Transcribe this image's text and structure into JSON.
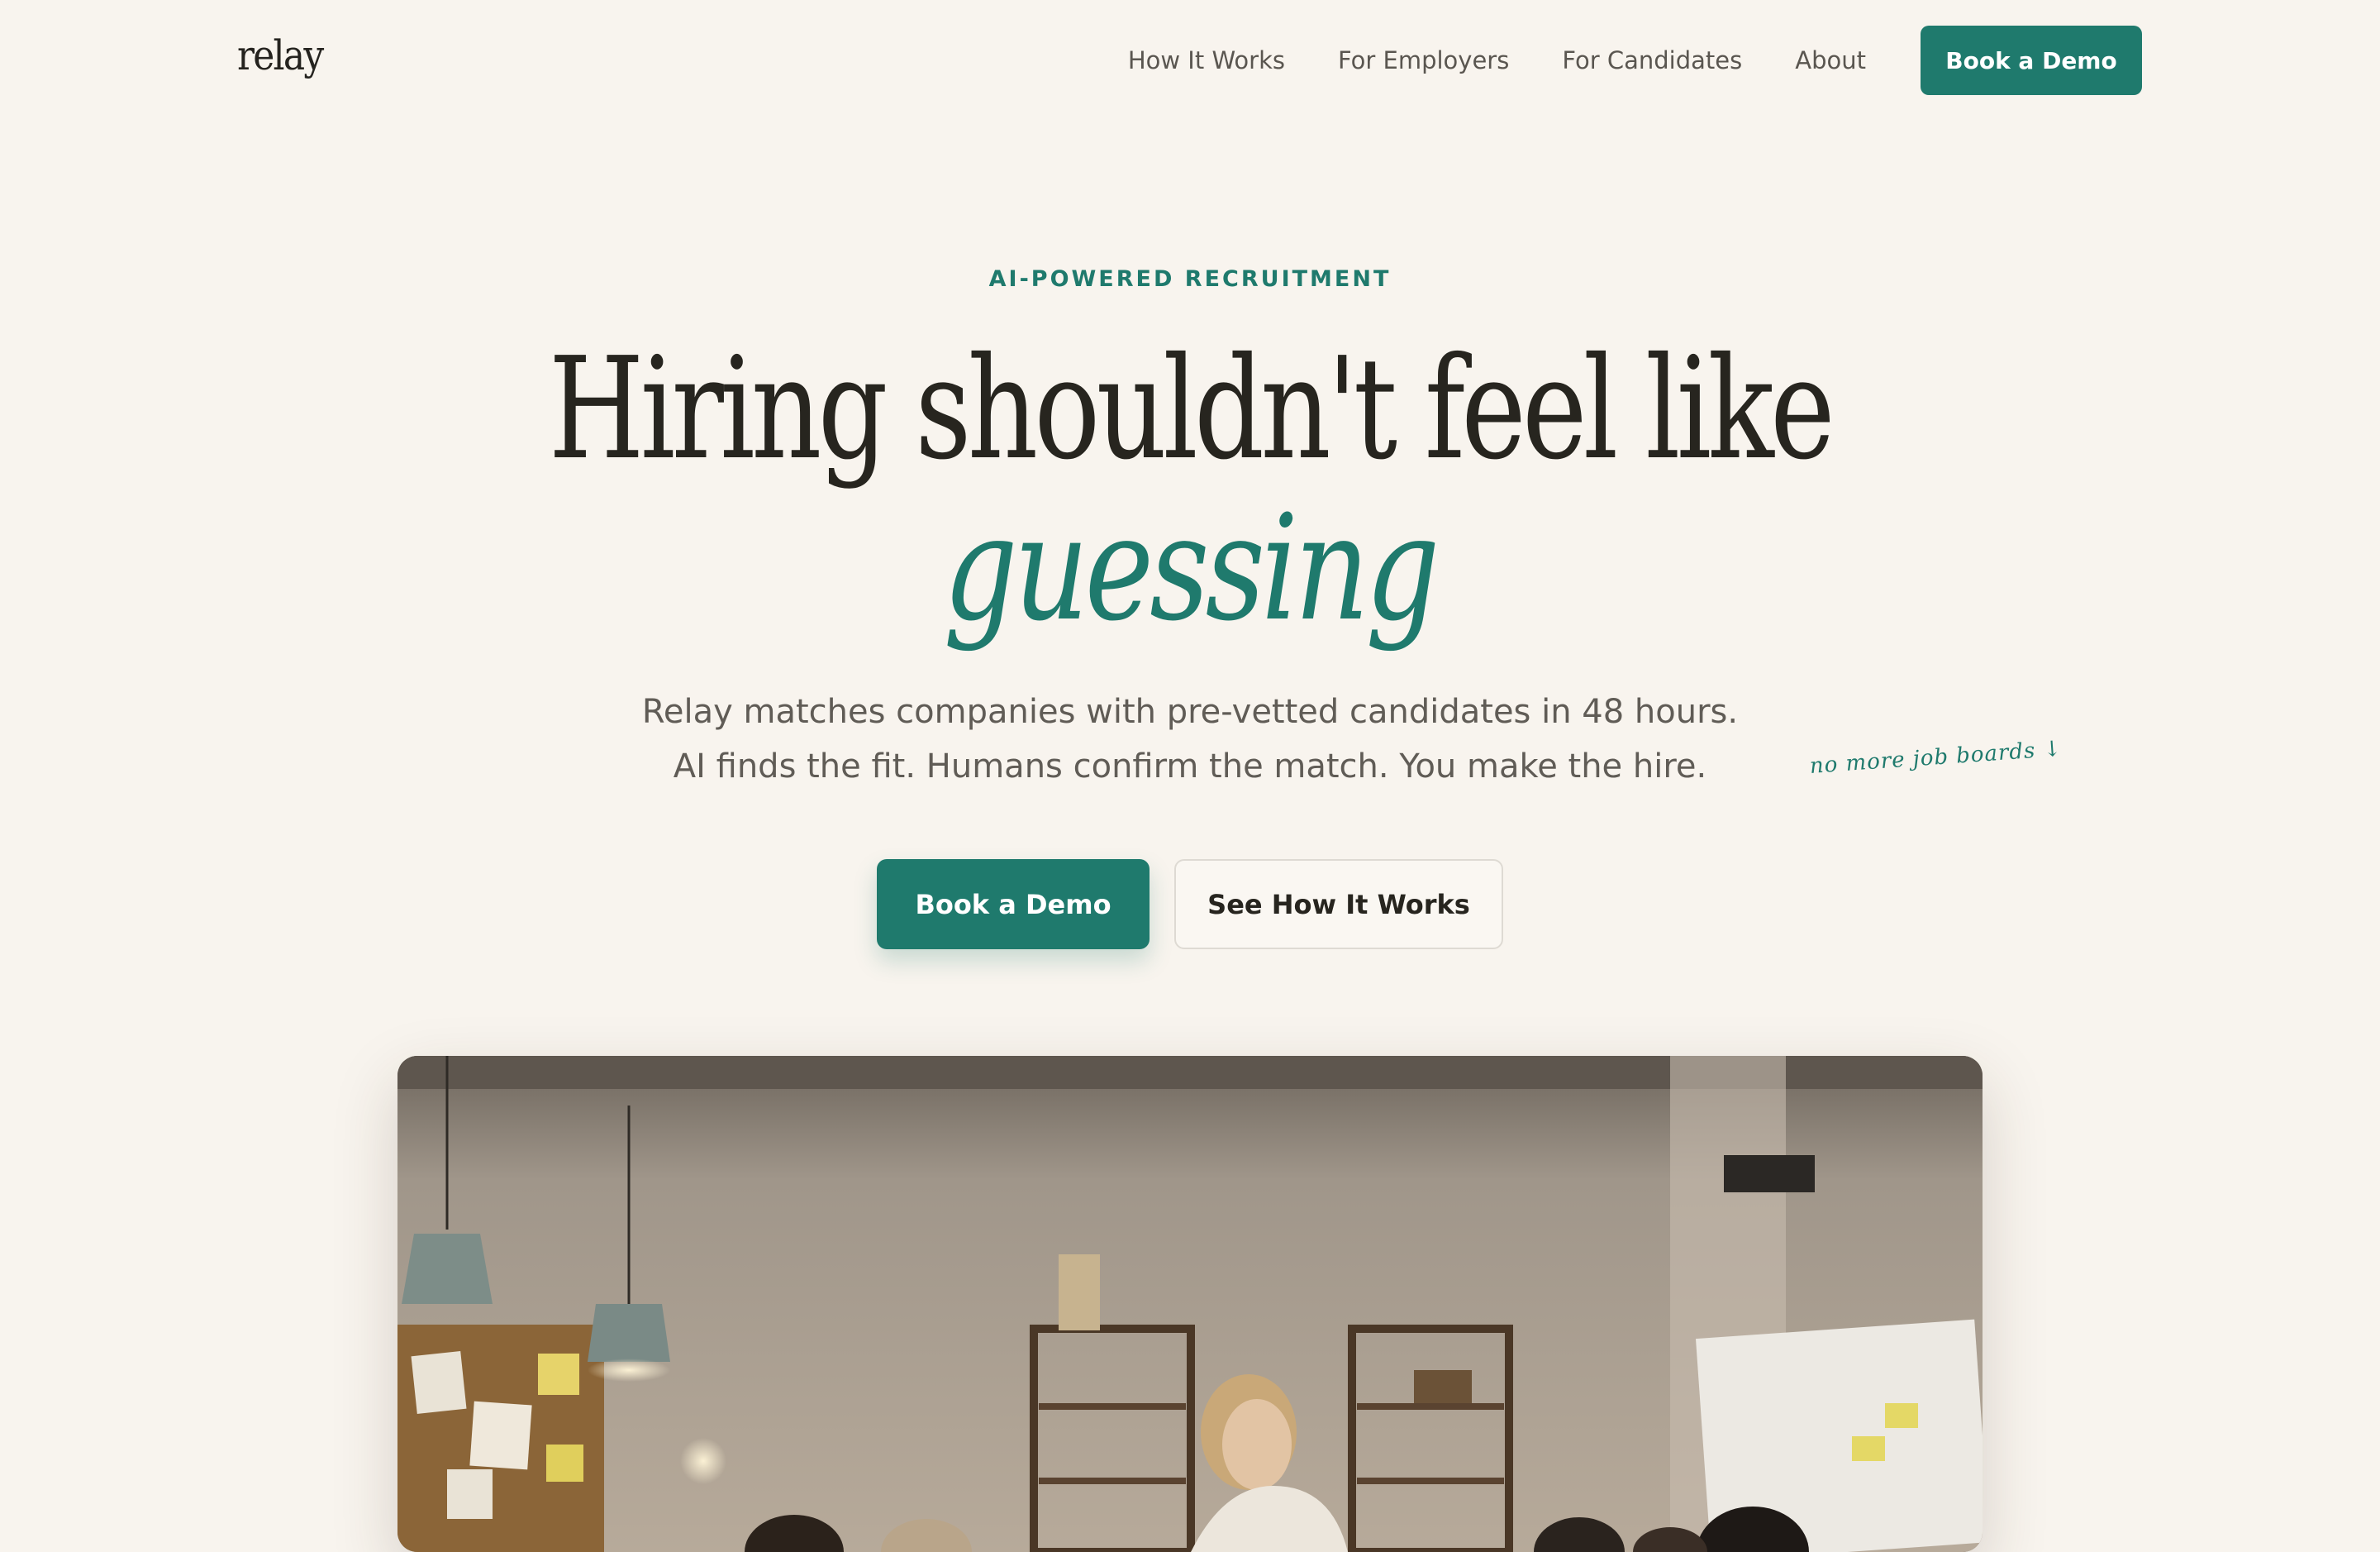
{
  "nav": {
    "logo": "relay",
    "links": [
      "How It Works",
      "For Employers",
      "For Candidates",
      "About"
    ],
    "cta": "Book a Demo"
  },
  "hero": {
    "eyebrow": "AI-POWERED RECRUITMENT",
    "headline": "Hiring shouldn't feel like",
    "headline_accent": "guessing",
    "subcopy": [
      "Relay matches companies with pre-vetted candidates in 48 hours.",
      "AI finds the fit. Humans confirm the match. You make the hire."
    ],
    "annotation": "no more job boards ↓",
    "primary_cta": "Book a Demo",
    "secondary_cta": "See How It Works"
  },
  "colors": {
    "accent": "#1f7a6d",
    "background": "#f8f4ee",
    "text": "#27251f"
  }
}
